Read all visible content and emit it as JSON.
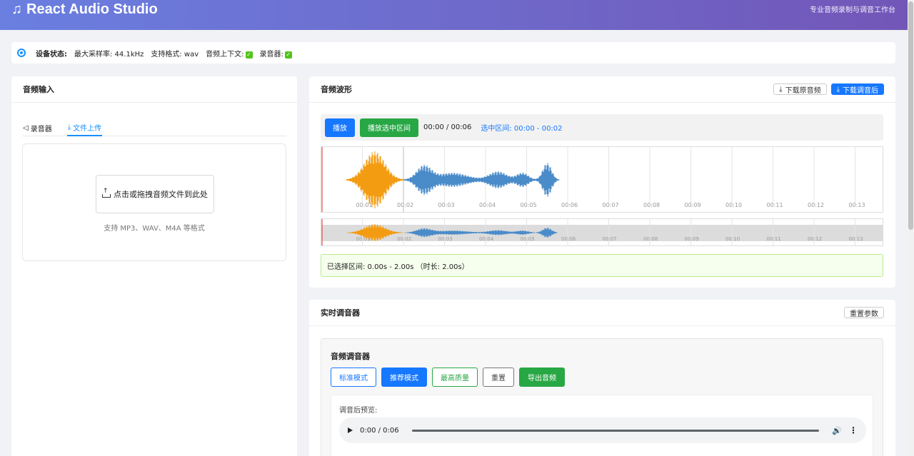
{
  "header": {
    "title": "React Audio Studio",
    "subtitle": "专业音频录制与调音工作台",
    "icon": "music-note-icon"
  },
  "status": {
    "label": "设备状态:",
    "sample_rate": "最大采样率: 44.1kHz",
    "format": "支持格式: wav",
    "audio_context": "音频上下文:",
    "recorder": "录音器:",
    "check": "✓"
  },
  "input_card": {
    "title": "音频输入",
    "tabs": [
      {
        "label": "录音器",
        "active": false
      },
      {
        "label": "文件上传",
        "active": true
      }
    ],
    "upload_label": "点击或拖拽音频文件到此处",
    "upload_hint": "支持 MP3、WAV、M4A 等格式"
  },
  "wave_card": {
    "title": "音频波形",
    "download_original": "下载原音频",
    "download_mixed": "下载调音后",
    "play": "播放",
    "play_selection": "播放选中区间",
    "time": "00:00 / 00:06",
    "selection": "选中区间: 00:00 - 00:02",
    "ticks": [
      "00:01",
      "00:02",
      "00:03",
      "00:04",
      "00:05",
      "00:06",
      "00:07",
      "00:08",
      "00:09",
      "00:10",
      "00:11",
      "00:12",
      "00:13"
    ],
    "info": "已选择区间: 0.00s - 2.00s （时长: 2.00s）",
    "selected_color": "#f39c12",
    "wave_color": "#4a8bc9"
  },
  "mixer_card": {
    "title": "实时调音器",
    "reset_params": "重置参数",
    "inner_title": "音频调音器",
    "buttons": {
      "standard": "标准模式",
      "recommended": "推荐模式",
      "best": "最高质量",
      "reset": "重置",
      "export": "导出音频"
    },
    "preview_label": "调音后预览:",
    "player_time": "0:00 / 0:06"
  }
}
